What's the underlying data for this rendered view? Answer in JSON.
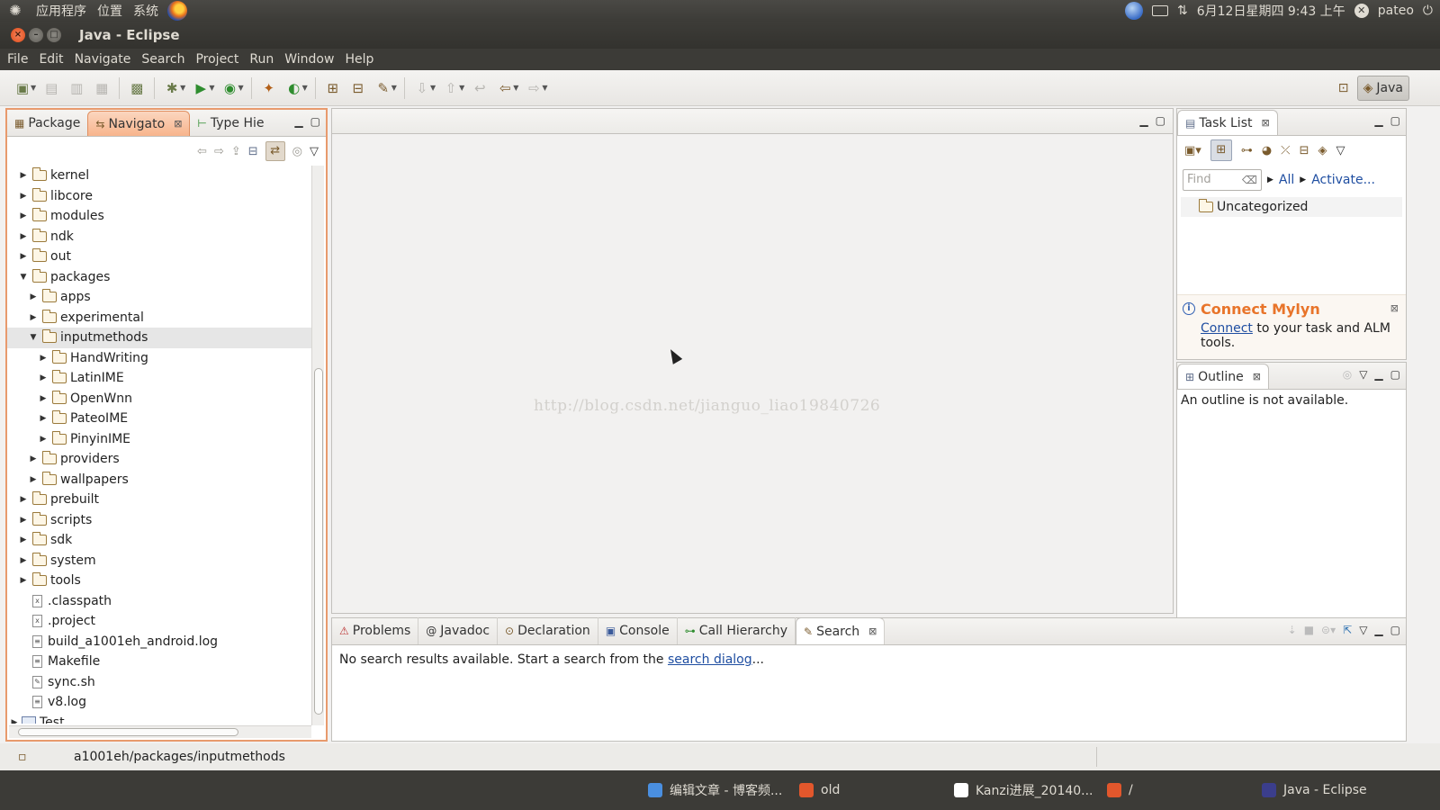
{
  "gnome_panel": {
    "menus": [
      "应用程序",
      "位置",
      "系统"
    ],
    "clock": "6月12日星期四  9:43 上午",
    "user": "pateo"
  },
  "window": {
    "title": "Java - Eclipse"
  },
  "menubar": [
    "File",
    "Edit",
    "Navigate",
    "Search",
    "Project",
    "Run",
    "Window",
    "Help"
  ],
  "perspective": {
    "active": "Java"
  },
  "left_panel": {
    "tabs": [
      {
        "label": "Package"
      },
      {
        "label": "Navigato"
      },
      {
        "label": "Type Hie"
      }
    ],
    "tree": [
      {
        "label": "kernel",
        "depth": 0,
        "kind": "folder",
        "expanded": false
      },
      {
        "label": "libcore",
        "depth": 0,
        "kind": "folder",
        "expanded": false
      },
      {
        "label": "modules",
        "depth": 0,
        "kind": "folder",
        "expanded": false
      },
      {
        "label": "ndk",
        "depth": 0,
        "kind": "folder",
        "expanded": false
      },
      {
        "label": "out",
        "depth": 0,
        "kind": "folder",
        "expanded": false
      },
      {
        "label": "packages",
        "depth": 0,
        "kind": "folder",
        "expanded": true
      },
      {
        "label": "apps",
        "depth": 1,
        "kind": "folder",
        "expanded": false
      },
      {
        "label": "experimental",
        "depth": 1,
        "kind": "folder",
        "expanded": false
      },
      {
        "label": "inputmethods",
        "depth": 1,
        "kind": "folder",
        "expanded": true,
        "selected": true
      },
      {
        "label": "HandWriting",
        "depth": 2,
        "kind": "folder",
        "expanded": false
      },
      {
        "label": "LatinIME",
        "depth": 2,
        "kind": "folder",
        "expanded": false
      },
      {
        "label": "OpenWnn",
        "depth": 2,
        "kind": "folder",
        "expanded": false
      },
      {
        "label": "PateoIME",
        "depth": 2,
        "kind": "folder",
        "expanded": false
      },
      {
        "label": "PinyinIME",
        "depth": 2,
        "kind": "folder",
        "expanded": false
      },
      {
        "label": "providers",
        "depth": 1,
        "kind": "folder",
        "expanded": false
      },
      {
        "label": "wallpapers",
        "depth": 1,
        "kind": "folder",
        "expanded": false
      },
      {
        "label": "prebuilt",
        "depth": 0,
        "kind": "folder",
        "expanded": false
      },
      {
        "label": "scripts",
        "depth": 0,
        "kind": "folder",
        "expanded": false
      },
      {
        "label": "sdk",
        "depth": 0,
        "kind": "folder",
        "expanded": false
      },
      {
        "label": "system",
        "depth": 0,
        "kind": "folder",
        "expanded": false
      },
      {
        "label": "tools",
        "depth": 0,
        "kind": "folder",
        "expanded": false
      },
      {
        "label": ".classpath",
        "depth": 0,
        "kind": "xml"
      },
      {
        "label": ".project",
        "depth": 0,
        "kind": "xml"
      },
      {
        "label": "build_a1001eh_android.log",
        "depth": 0,
        "kind": "file"
      },
      {
        "label": "Makefile",
        "depth": 0,
        "kind": "file"
      },
      {
        "label": "sync.sh",
        "depth": 0,
        "kind": "script"
      },
      {
        "label": "v8.log",
        "depth": 0,
        "kind": "file"
      },
      {
        "label": "Test",
        "depth": -1,
        "kind": "project",
        "expanded": false
      }
    ]
  },
  "editor": {
    "watermark": "http://blog.csdn.net/jianguo_liao19840726"
  },
  "task_list": {
    "tab": "Task List",
    "find_placeholder": "Find",
    "all": "All",
    "activate": "Activate...",
    "category": "Uncategorized",
    "mylyn_title": "Connect Mylyn",
    "mylyn_link": "Connect",
    "mylyn_text": " to your task and ALM tools."
  },
  "outline": {
    "tab": "Outline",
    "message": "An outline is not available."
  },
  "bottom_panel": {
    "tabs": [
      "Problems",
      "Javadoc",
      "Declaration",
      "Console",
      "Call Hierarchy",
      "Search"
    ],
    "message_prefix": "No search results available. Start a search from the ",
    "message_link": "search dialog",
    "message_suffix": "..."
  },
  "status": {
    "path": "a1001eh/packages/inputmethods"
  },
  "taskbar": [
    {
      "label": "编辑文章 - 博客频...",
      "icon": "chrome-icon",
      "color": "#4a8fe0"
    },
    {
      "label": "old",
      "icon": "folder-icon",
      "color": "#e2572c"
    },
    {
      "label": "Kanzi进展_20140...",
      "icon": "document-icon",
      "color": "#ffffff"
    },
    {
      "label": "/",
      "icon": "folder-icon",
      "color": "#e2572c"
    },
    {
      "label": "Java - Eclipse",
      "icon": "eclipse-icon",
      "color": "#3b3e8c"
    }
  ]
}
